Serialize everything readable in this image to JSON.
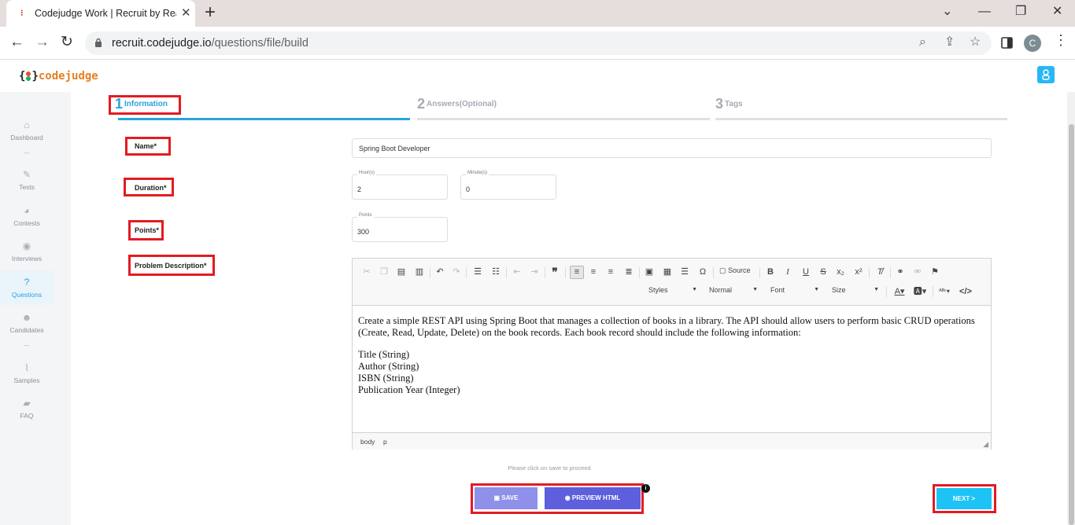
{
  "browser": {
    "tab_title": "Codejudge Work | Recruit by Rea",
    "url_host": "recruit.codejudge.io",
    "url_path": "/questions/file/build",
    "profile_initial": "C"
  },
  "app": {
    "logo_text": "codejudge",
    "accent_color": "#29a3dc",
    "brand_color": "#e67e22"
  },
  "sidebar": {
    "items": [
      {
        "label": "Dashboard",
        "icon": "home-icon"
      },
      {
        "label": "Tests",
        "icon": "pencil-icon"
      },
      {
        "label": "Contests",
        "icon": "pie-chart-icon"
      },
      {
        "label": "Interviews",
        "icon": "location-pin-icon"
      },
      {
        "label": "Questions",
        "icon": "question-circle-icon",
        "active": true
      },
      {
        "label": "Candidates",
        "icon": "users-icon"
      },
      {
        "label": "Samples",
        "icon": "line-chart-icon"
      },
      {
        "label": "FAQ",
        "icon": "chat-bubbles-icon"
      }
    ],
    "separator": "---"
  },
  "steps": [
    {
      "num": "1",
      "label": "Information",
      "active": true
    },
    {
      "num": "2",
      "label": "Answers(Optional)",
      "active": false
    },
    {
      "num": "3",
      "label": "Tags",
      "active": false
    }
  ],
  "form": {
    "name_label": "Name*",
    "name_value": "Spring Boot Developer",
    "duration_label": "Duration*",
    "hours_label": "Hour(s)",
    "hours_value": "2",
    "minutes_label": "Minute(s)",
    "minutes_value": "0",
    "points_label": "Points*",
    "points_field_label": "Points",
    "points_value": "300",
    "description_label": "Problem Description*"
  },
  "editor": {
    "source_label": "Source",
    "styles_label": "Styles",
    "format_label": "Normal",
    "font_label": "Font",
    "size_label": "Size",
    "paragraph_1": "Create a simple REST API using Spring Boot that manages a collection of books in a library. The API should allow users to perform basic CRUD operations (Create, Read, Update, Delete) on the book records. Each book record should include the following information:",
    "lines": [
      "Title (String)",
      "Author (String)",
      "ISBN (String)",
      "Publication Year (Integer)"
    ],
    "status_body": "body",
    "status_p": "p"
  },
  "footer": {
    "hint": "Please click on save to proceed",
    "save_label": "SAVE",
    "preview_label": "PREVIEW HTML",
    "next_label": "NEXT >"
  }
}
